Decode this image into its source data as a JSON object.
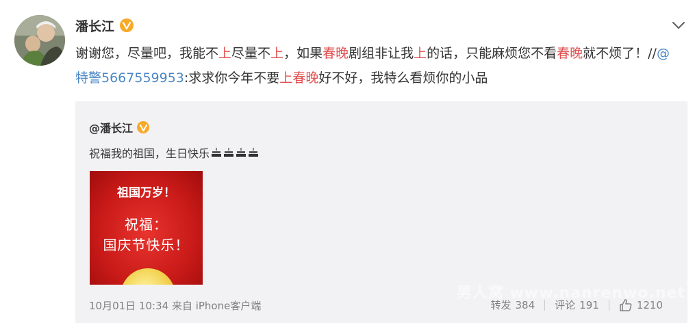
{
  "post": {
    "author": "潘长江",
    "text": [
      {
        "t": "谢谢您，尽量吧，我能不",
        "k": "plain"
      },
      {
        "t": "上",
        "k": "hl"
      },
      {
        "t": "尽量不",
        "k": "plain"
      },
      {
        "t": "上",
        "k": "hl"
      },
      {
        "t": "，如果",
        "k": "plain"
      },
      {
        "t": "春晚",
        "k": "hl"
      },
      {
        "t": "剧组非让我",
        "k": "plain"
      },
      {
        "t": "上",
        "k": "hl"
      },
      {
        "t": "的话，只能麻烦您不看",
        "k": "plain"
      },
      {
        "t": "春晚",
        "k": "hl"
      },
      {
        "t": "就不烦了！//",
        "k": "plain"
      },
      {
        "t": "@特警5667559953",
        "k": "mention"
      },
      {
        "t": ":求求你今年不要",
        "k": "plain"
      },
      {
        "t": "上",
        "k": "hl"
      },
      {
        "t": "春晚",
        "k": "hl"
      },
      {
        "t": "好不好，我特么看烦你的小品",
        "k": "plain"
      }
    ]
  },
  "repost": {
    "author": "@潘长江",
    "text": "祝福我的祖国，生日快乐",
    "emoji_count": 4,
    "image": {
      "line1": "祖国万岁！",
      "line2": "祝福：",
      "line3": "国庆节快乐！"
    },
    "meta": "10月01日 10:34 来自 iPhone客户端",
    "actions": {
      "forward_label": "转发",
      "forward_count": "384",
      "comment_label": "评论",
      "comment_count": "191",
      "like_count": "1210"
    }
  },
  "watermark": "男人窝 www.nanrenwo.net",
  "colors": {
    "highlight": "#e0504e",
    "mention": "#4a86c5",
    "verified_badge": "#f7a928",
    "repost_bg": "#f2f2f5"
  },
  "icons": [
    "verified-badge-icon",
    "chevron-down-icon",
    "cake-icon",
    "thumbs-up-icon"
  ]
}
